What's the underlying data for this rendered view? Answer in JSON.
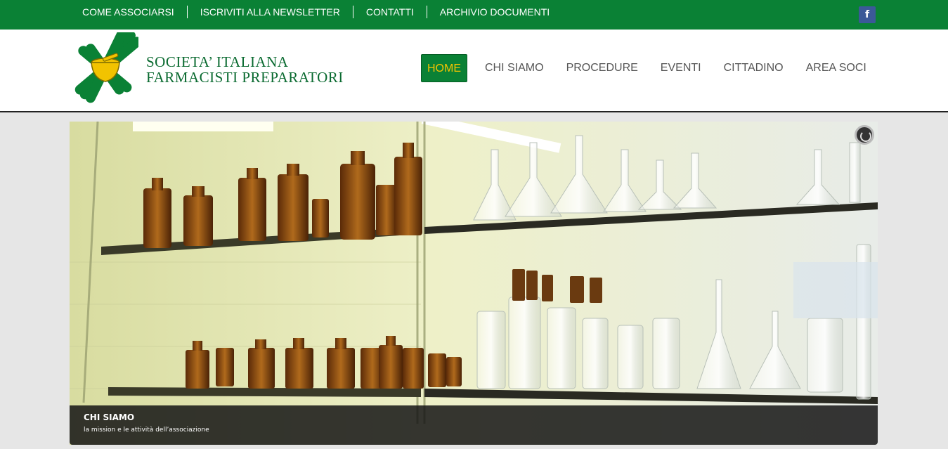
{
  "topbar": {
    "links": [
      "COME ASSOCIARSI",
      "ISCRIVITI ALLA NEWSLETTER",
      "CONTATTI",
      "ARCHIVIO DOCUMENTI"
    ],
    "social_icon": "f"
  },
  "brand": {
    "line1": "SOCIETA’ ITALIANA",
    "line2": "FARMACISTI PREPARATORI"
  },
  "mainnav": {
    "items": [
      "HOME",
      "CHI SIAMO",
      "PROCEDURE",
      "EVENTI",
      "CITTADINO",
      "AREA SOCI"
    ],
    "active": "HOME"
  },
  "slider": {
    "caption_title": "CHI SIAMO",
    "caption_text": "la mission e le attività dell’associazione"
  },
  "colors": {
    "brand_green": "#0a8135",
    "active_text": "#f5c400"
  }
}
